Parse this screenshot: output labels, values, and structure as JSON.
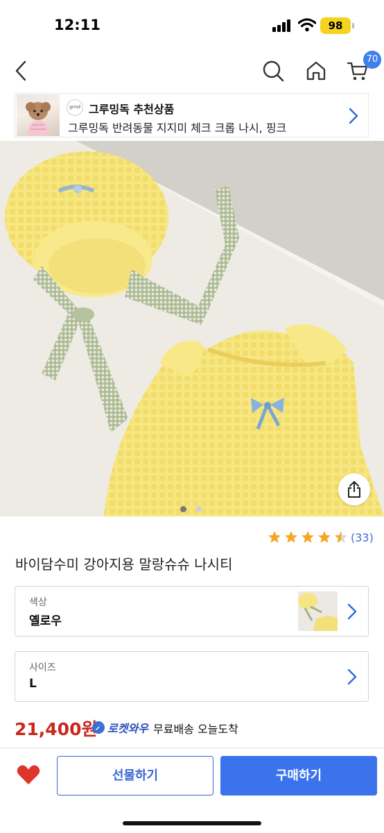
{
  "status_bar": {
    "time": "12:11",
    "battery": "98"
  },
  "nav": {
    "cart_count": "70"
  },
  "recommendation": {
    "logo_text": "grmd",
    "title": "그루밍독 추천상품",
    "subtitle": "그루밍독 반려동물 지지미 체크 크롭 나시, 핑크"
  },
  "product": {
    "rating": 4.5,
    "review_count": "(33)",
    "title": "바이담수미 강아지용 말랑슈슈 나시티",
    "image_count": 2,
    "active_image": 1
  },
  "options": {
    "color": {
      "label": "색상",
      "value": "옐로우"
    },
    "size": {
      "label": "사이즈",
      "value": "L"
    }
  },
  "pricing": {
    "price": "21,400원",
    "rocket_label": "로켓와우",
    "delivery": "무료배송 오늘도착"
  },
  "actions": {
    "gift_label": "선물하기",
    "buy_label": "구매하기"
  },
  "colors": {
    "accent": "#3a73ec",
    "price": "#c9271d",
    "star": "#f5a623",
    "heart": "#e0342b"
  }
}
